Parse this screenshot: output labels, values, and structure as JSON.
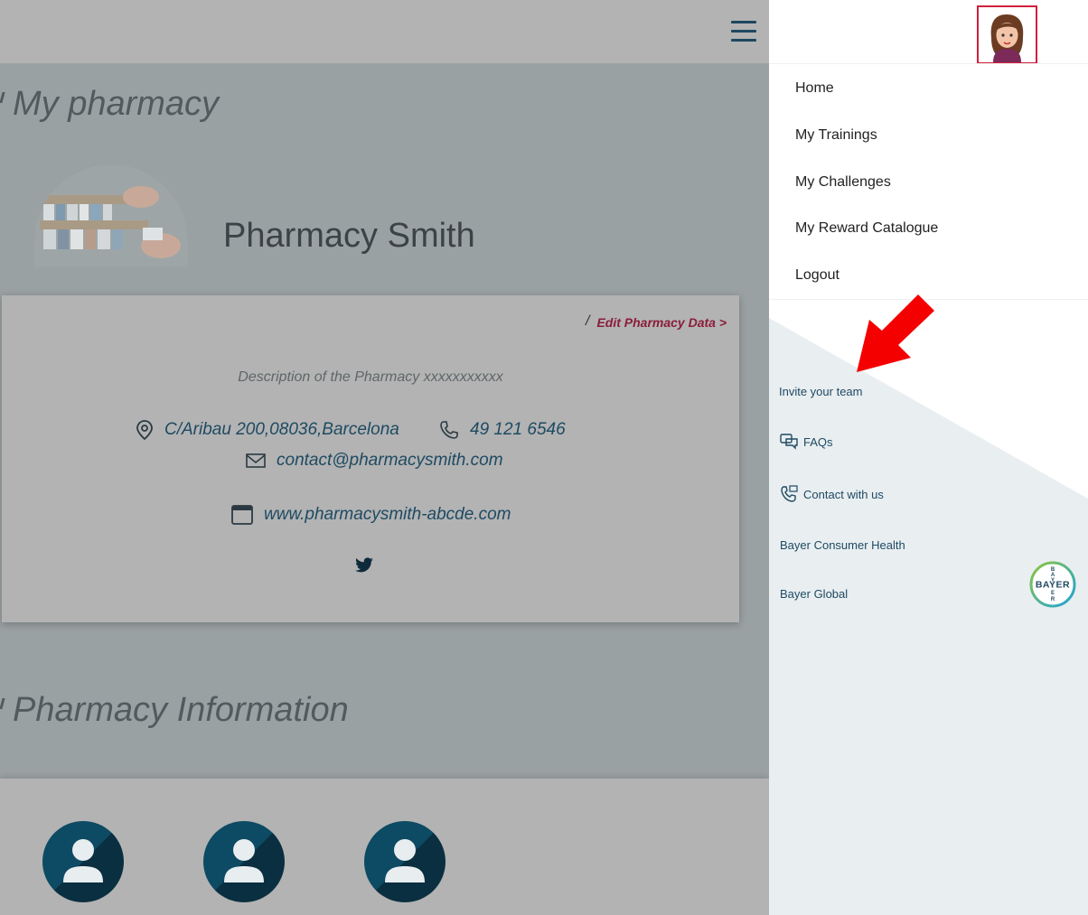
{
  "left": {
    "section_title": "My pharmacy",
    "pharmacy_name": "Pharmacy Smith",
    "card": {
      "edit_slash": "/",
      "edit_link": "Edit Pharmacy Data >",
      "description": "Description of the Pharmacy xxxxxxxxxxx",
      "address": "C/Aribau 200,08036,Barcelona",
      "phone": "49 121 6546",
      "email": "contact@pharmacysmith.com",
      "website": "www.pharmacysmith-abcde.com"
    },
    "info_title": "Pharmacy Information"
  },
  "sidebar": {
    "menu": [
      "Home",
      "My Trainings",
      "My Challenges",
      "My Reward Catalogue",
      "Logout"
    ],
    "links": {
      "invite": "Invite your team",
      "faqs": "FAQs",
      "contact": "Contact with us",
      "consumer": "Bayer Consumer Health",
      "global": "Bayer Global"
    },
    "logo_text": "BAYER"
  },
  "colors": {
    "accent_red": "#d21f3c",
    "link_dark_blue": "#1e4a62",
    "edit_link": "#8b1d3b"
  },
  "icons": [
    "hamburger-icon",
    "location-icon",
    "phone-icon",
    "email-icon",
    "browser-icon",
    "twitter-icon",
    "faq-chat-icon",
    "contact-phone-icon",
    "user-avatar-icon"
  ]
}
